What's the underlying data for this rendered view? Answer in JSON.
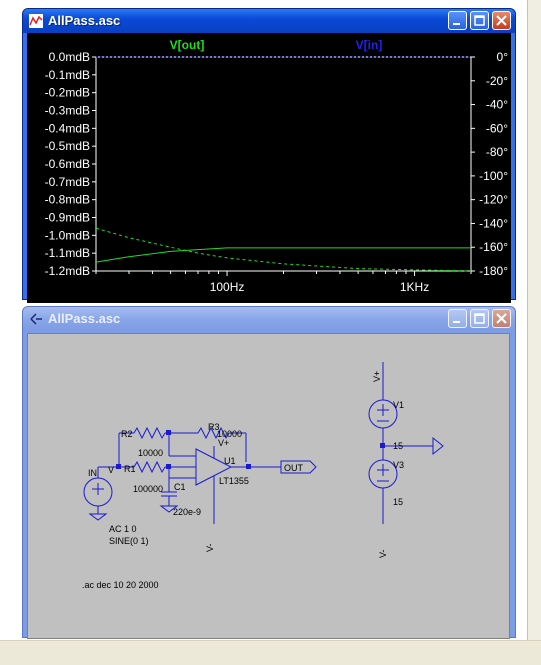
{
  "plot_window": {
    "title": "AllPass.asc",
    "trace_out_label": "V[out]",
    "trace_in_label": "V[in]",
    "left_ticks": [
      "0.0mdB",
      "-0.1mdB",
      "-0.2mdB",
      "-0.3mdB",
      "-0.4mdB",
      "-0.5mdB",
      "-0.6mdB",
      "-0.7mdB",
      "-0.8mdB",
      "-0.9mdB",
      "-1.0mdB",
      "-1.1mdB",
      "-1.2mdB"
    ],
    "right_ticks": [
      "0°",
      "-20°",
      "-40°",
      "-60°",
      "-80°",
      "-100°",
      "-120°",
      "-140°",
      "-160°",
      "-180°"
    ],
    "x_ticks": [
      "100Hz",
      "1KHz"
    ],
    "colors": {
      "out": "#22dd22",
      "in": "#2222ee",
      "background": "#000000"
    }
  },
  "schematic_window": {
    "title": "AllPass.asc",
    "labels": {
      "r2": "R2",
      "r2_val": "10000",
      "r3": "R3",
      "r3_val": "10000",
      "r1": "R1",
      "r1_val": "100000",
      "c1": "C1",
      "c1_val": "220e-9",
      "u1": "U1",
      "u1_model": "LT1355",
      "in_net": "IN",
      "v_net": "V",
      "vplus_pin": "V+",
      "vminus_pin": "V-",
      "out_net": "OUT",
      "ac_spec": "AC 1 0",
      "sine_spec": "SINE(0 1)",
      "v1": "V1",
      "v1_val": "15",
      "v3": "V3",
      "v3_val": "15",
      "vplus_supply": "V+",
      "vminus_supply": "V-",
      "directive": ".ac dec 10 20 2000"
    }
  },
  "chart_data": {
    "type": "line",
    "x": [
      20,
      30,
      50,
      70,
      100,
      200,
      500,
      1000,
      2000
    ],
    "series": [
      {
        "name": "V[out]",
        "axis": "left",
        "values": [
          -1.15,
          -1.12,
          -1.09,
          -1.08,
          -1.07,
          -1.07,
          -1.07,
          -1.07,
          -1.07
        ]
      },
      {
        "name": "V[in]",
        "axis": "left",
        "values": [
          0,
          0,
          0,
          0,
          0,
          0,
          0,
          0,
          0
        ]
      },
      {
        "name": "V[out] phase",
        "axis": "right",
        "values": [
          -144,
          -152,
          -160,
          -165,
          -169,
          -174,
          -178,
          -179,
          -180
        ]
      }
    ],
    "xscale": "log",
    "xlim": [
      20,
      2000
    ],
    "ylim_left": [
      -1.2,
      0
    ],
    "ylim_right": [
      -180,
      0
    ],
    "ylabel_left_unit": "mdB",
    "ylabel_right_unit": "°"
  }
}
